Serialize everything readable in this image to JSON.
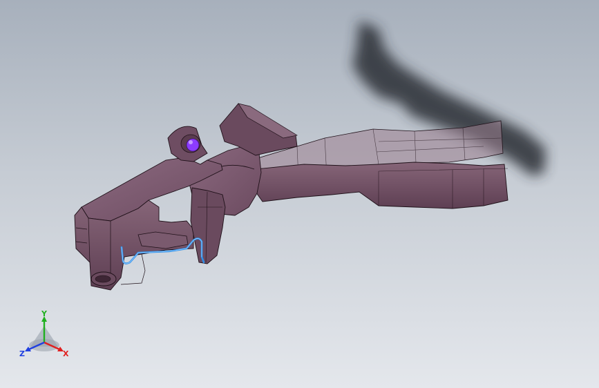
{
  "viewport": {
    "background_top": "#a7b0bc",
    "background_bottom": "#e4e7ec"
  },
  "model": {
    "body_color": "#6e4d62",
    "body_dark": "#4a3040",
    "body_light": "#8e6d82",
    "edge_color": "#1e1018",
    "transparent_color": "#8a6a7e",
    "bolt_color": "#8c3cff",
    "wire_color": "#2e8fe8",
    "shadow_color": "#2b2f36"
  },
  "triad": {
    "x_label": "X",
    "y_label": "Y",
    "z_label": "Z",
    "x_color": "#e02020",
    "y_color": "#20b020",
    "z_color": "#2040e0"
  }
}
